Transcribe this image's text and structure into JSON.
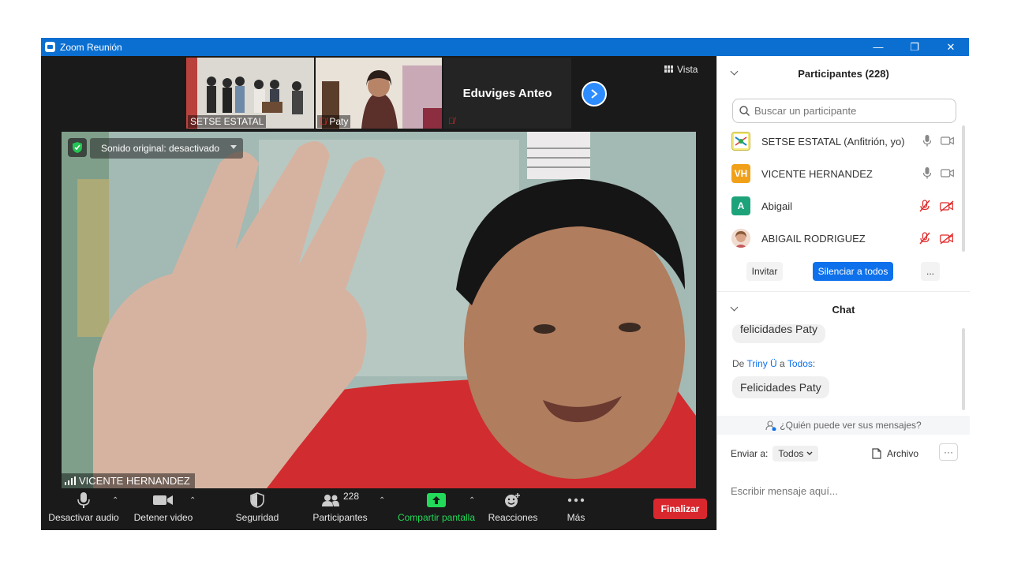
{
  "window": {
    "title": "Zoom Reunión",
    "controls": {
      "minimize": "—",
      "restore": "❐",
      "close": "✕"
    }
  },
  "video": {
    "strip": [
      {
        "label": "SETSE ESTATAL",
        "muted": false
      },
      {
        "label": "Paty",
        "muted": true
      },
      {
        "label": "Eduviges Anteo",
        "muted": true
      }
    ],
    "view_label": "Vista",
    "sound_status": "Sonido original: desactivado",
    "active_speaker": "VICENTE HERNANDEZ"
  },
  "toolbar": {
    "mute": "Desactivar audio",
    "video": "Detener video",
    "security": "Seguridad",
    "participants": "Participantes",
    "participants_count": "228",
    "share": "Compartir pantalla",
    "reactions": "Reacciones",
    "more": "Más",
    "end": "Finalizar"
  },
  "participants_panel": {
    "title": "Participantes (228)",
    "search_placeholder": "Buscar un participante",
    "list": [
      {
        "name": "SETSE ESTATAL (Anfitrión, yo)",
        "avatar": "logo",
        "mic_muted": false,
        "video_off": false
      },
      {
        "name": "VICENTE HERNANDEZ",
        "avatar": "VH",
        "avatar_color": "#f0a019",
        "mic_muted": false,
        "video_off": false
      },
      {
        "name": "Abigail",
        "avatar": "A",
        "avatar_color": "#1da37a",
        "mic_muted": true,
        "video_off": true
      },
      {
        "name": "ABIGAIL RODRIGUEZ",
        "avatar": "photo",
        "mic_muted": true,
        "video_off": true
      }
    ],
    "invite": "Invitar",
    "mute_all": "Silenciar a todos",
    "more": "..."
  },
  "chat": {
    "title": "Chat",
    "messages": [
      {
        "text": "felicidades Paty"
      }
    ],
    "last": {
      "prefix": "De",
      "sender": "Triny Ü",
      "connector": "a",
      "recipient": "Todos",
      "suffix": ":",
      "text": "Felicidades Paty"
    },
    "visibility": "¿Quién puede ver sus mensajes?",
    "send_to_label": "Enviar a:",
    "send_to_value": "Todos",
    "file_label": "Archivo",
    "more": "···",
    "input_placeholder": "Escribir mensaje aquí..."
  },
  "colors": {
    "accent": "#0e71eb",
    "titlebar": "#0b6fd2",
    "end_red": "#d9272e",
    "share_green": "#23d959",
    "muted_red": "#e02828"
  }
}
